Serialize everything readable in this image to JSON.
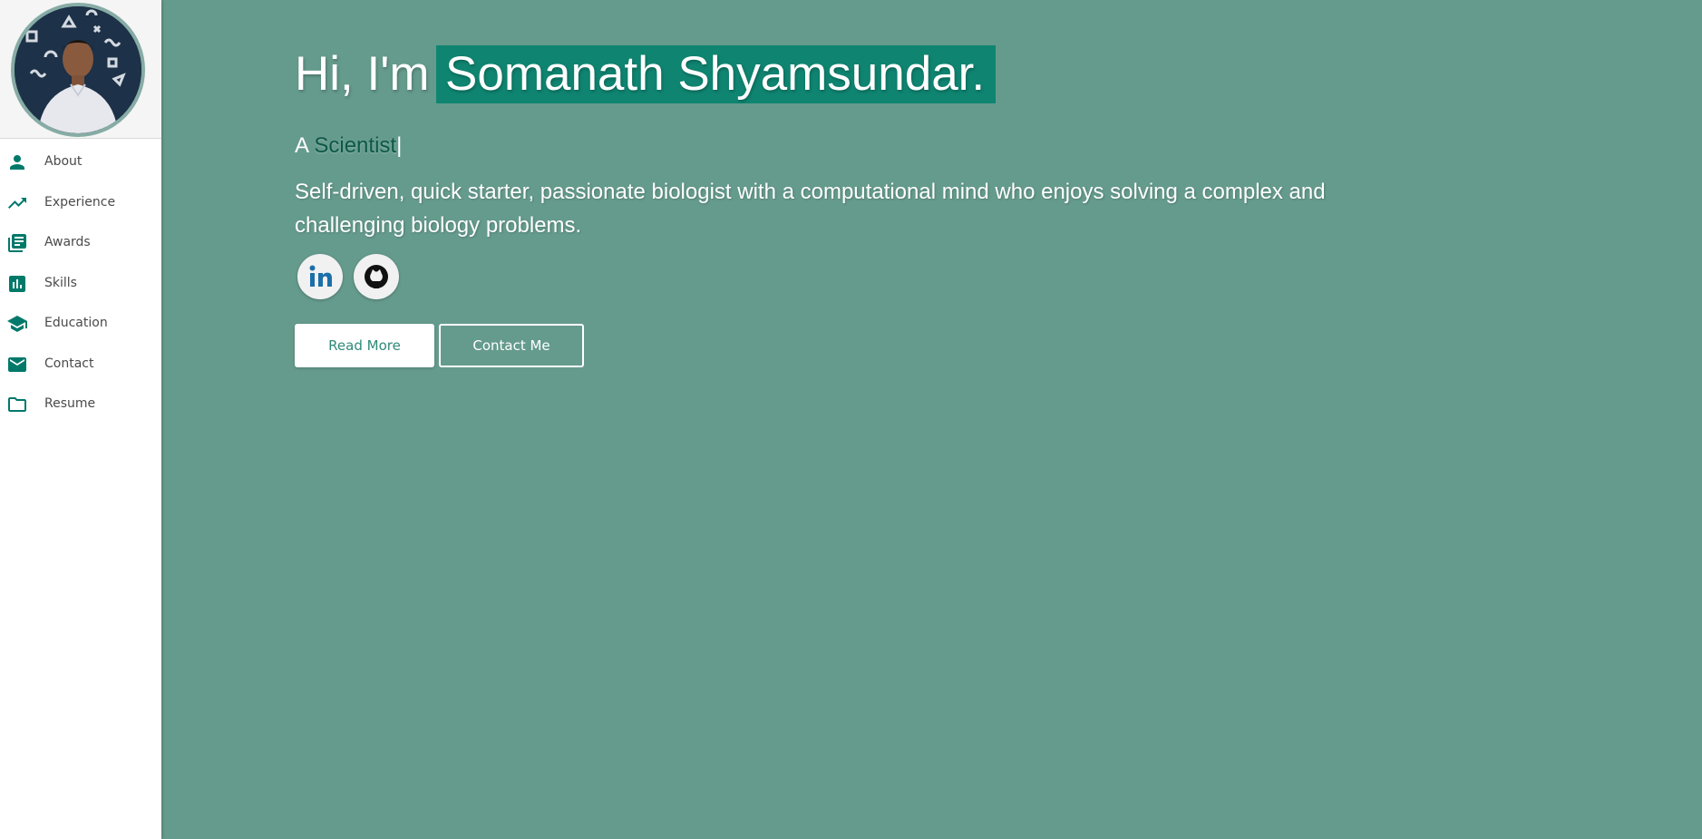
{
  "sidebar": {
    "items": [
      {
        "label": "About",
        "icon": "person-icon"
      },
      {
        "label": "Experience",
        "icon": "trending-up-icon"
      },
      {
        "label": "Awards",
        "icon": "library-books-icon"
      },
      {
        "label": "Skills",
        "icon": "bar-chart-icon"
      },
      {
        "label": "Education",
        "icon": "graduation-cap-icon"
      },
      {
        "label": "Contact",
        "icon": "mail-icon"
      },
      {
        "label": "Resume",
        "icon": "folder-icon"
      }
    ]
  },
  "hero": {
    "greeting": "Hi, I'm",
    "name": "Somanath Shyamsundar.",
    "role_prefix": "A",
    "role": "Scientist",
    "cursor": "|",
    "summary": "Self-driven, quick starter, passionate biologist with a computational mind who enjoys solving a complex and challenging biology problems.",
    "social": [
      {
        "name": "LinkedIn",
        "icon": "linkedin-icon"
      },
      {
        "name": "GitHub",
        "icon": "github-icon"
      }
    ],
    "read_more_label": "Read More",
    "contact_label": "Contact Me"
  },
  "colors": {
    "background": "#659b8d",
    "accent": "#0f8571",
    "icon": "#00796b",
    "sidebar": "#ffffff"
  }
}
